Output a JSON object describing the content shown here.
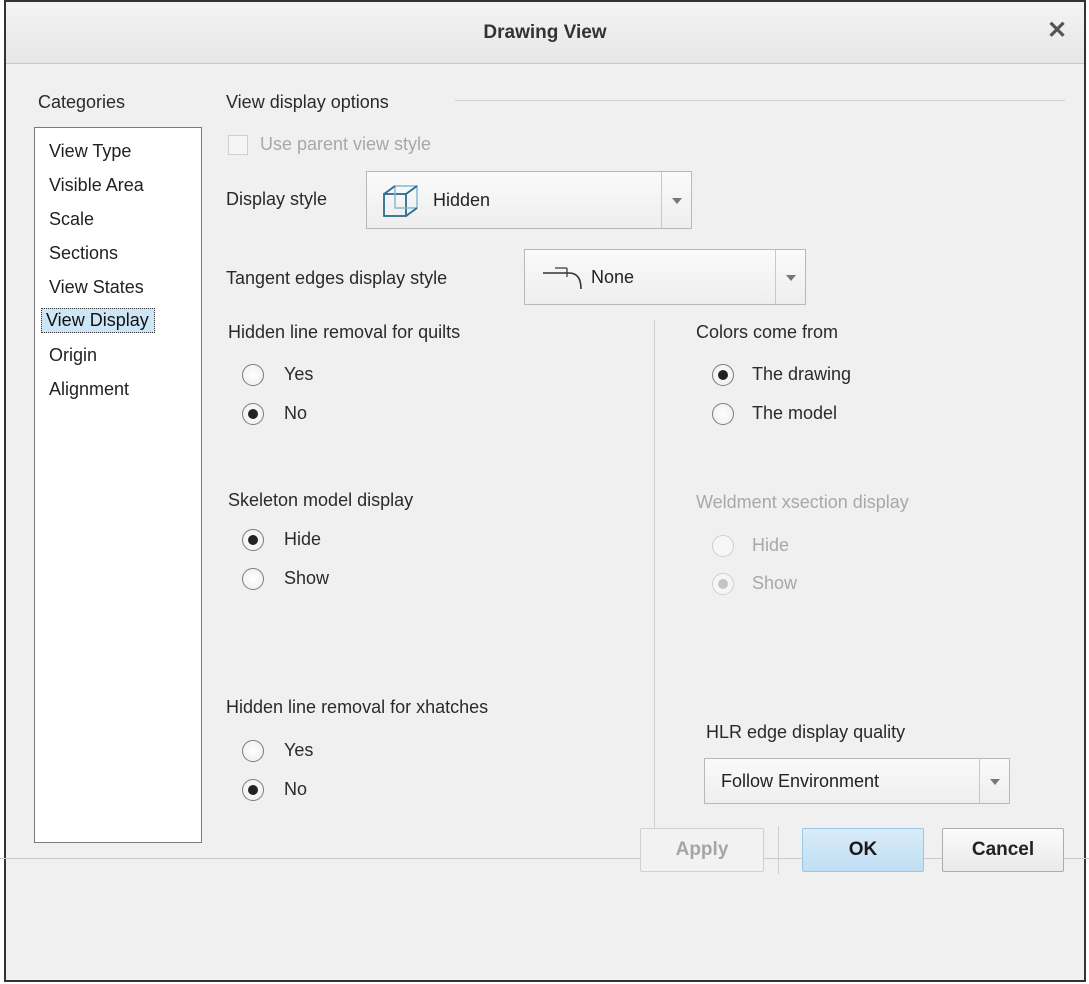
{
  "window": {
    "title": "Drawing View",
    "close_glyph": "✕"
  },
  "categories": {
    "label": "Categories",
    "items": [
      "View Type",
      "Visible Area",
      "Scale",
      "Sections",
      "View States",
      "View Display",
      "Origin",
      "Alignment"
    ],
    "selected": "View Display"
  },
  "view_display": {
    "section_label": "View display options",
    "use_parent_label": "Use parent view style",
    "display_style": {
      "label": "Display style",
      "value": "Hidden",
      "icon": "hidden-cube-icon"
    },
    "tangent_edges": {
      "label": "Tangent edges display style",
      "value": "None",
      "icon": "tangent-edge-icon"
    },
    "hlr_quilts": {
      "label": "Hidden line removal for quilts",
      "options": [
        "Yes",
        "No"
      ],
      "selected": "No"
    },
    "skeleton": {
      "label": "Skeleton model display",
      "options": [
        "Hide",
        "Show"
      ],
      "selected": "Hide"
    },
    "hlr_xhatches": {
      "label": "Hidden line removal for xhatches",
      "options": [
        "Yes",
        "No"
      ],
      "selected": "No"
    },
    "colors": {
      "label": "Colors come from",
      "options": [
        "The drawing",
        "The model"
      ],
      "selected": "The drawing"
    },
    "weldment": {
      "label": "Weldment xsection display",
      "options": [
        "Hide",
        "Show"
      ],
      "selected": "Show",
      "disabled": true
    },
    "hlr_quality": {
      "label": "HLR edge display quality",
      "value": "Follow Environment"
    }
  },
  "buttons": {
    "apply": "Apply",
    "ok": "OK",
    "cancel": "Cancel"
  },
  "colors": {
    "selection": "#cde6f7",
    "primary_button": "#c9e3f5",
    "icon_stroke": "#2b6d8f"
  }
}
